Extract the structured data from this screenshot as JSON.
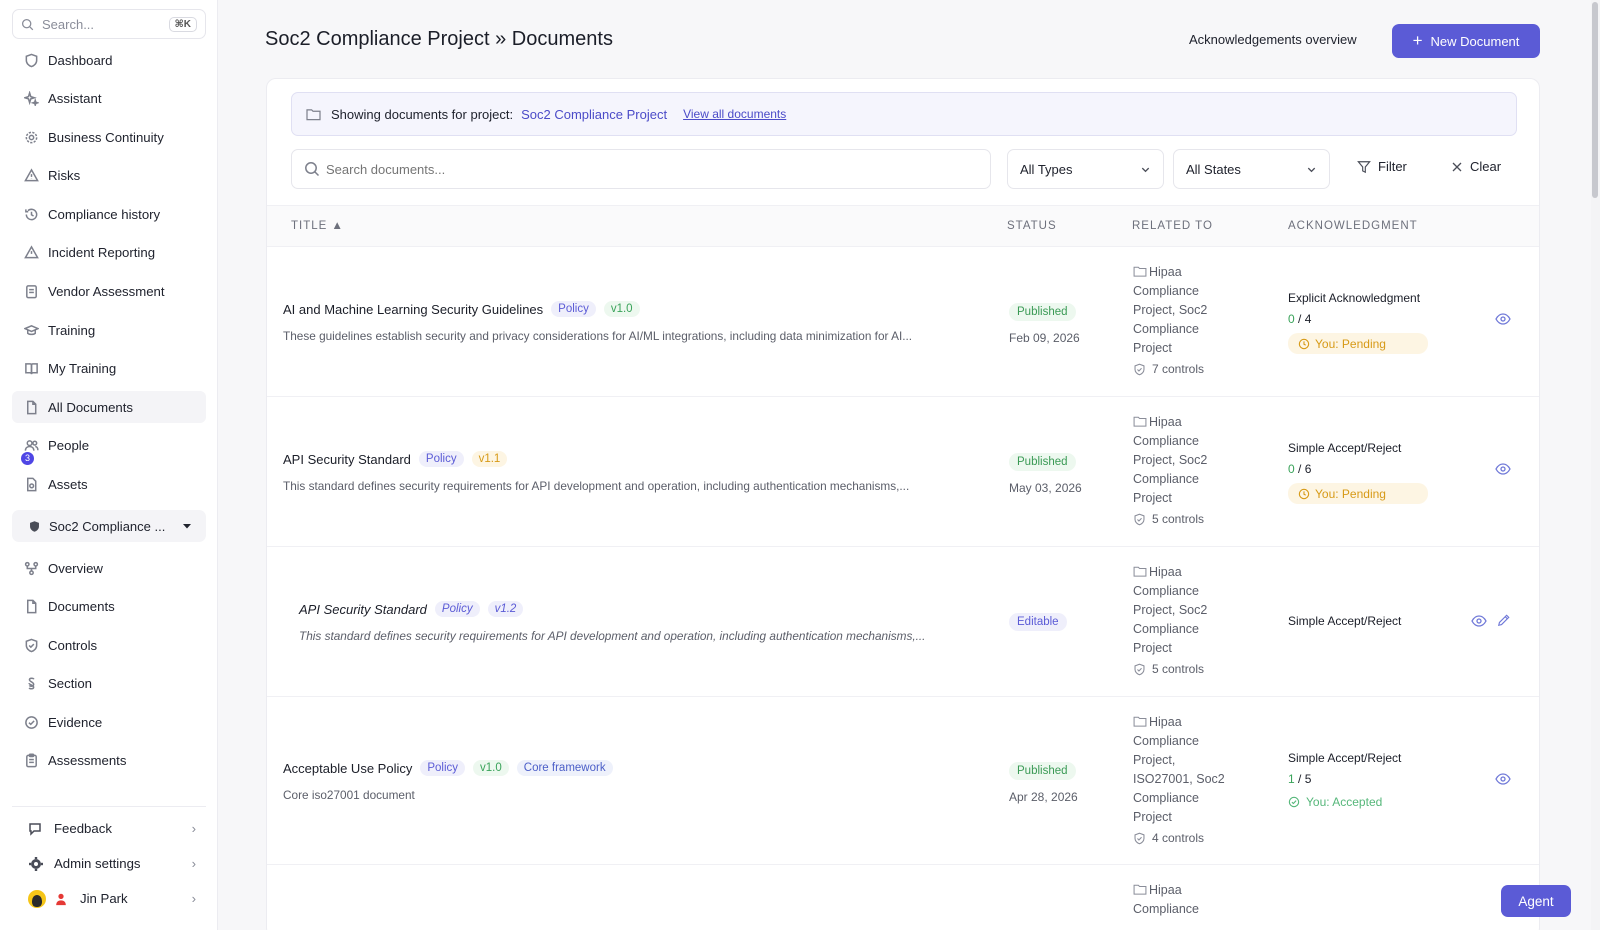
{
  "sidebar": {
    "search_placeholder": "Search...",
    "search_shortcut": "⌘K",
    "items": [
      {
        "label": "Dashboard",
        "icon": "shield-icon"
      },
      {
        "label": "Assistant",
        "icon": "sparkle-icon"
      },
      {
        "label": "Business Continuity",
        "icon": "gear-icon"
      },
      {
        "label": "Risks",
        "icon": "warning-icon"
      },
      {
        "label": "Compliance history",
        "icon": "history-icon"
      },
      {
        "label": "Incident Reporting",
        "icon": "alert-icon"
      },
      {
        "label": "Vendor Assessment",
        "icon": "clipboard-icon"
      },
      {
        "label": "Training",
        "icon": "graduation-cap-icon"
      },
      {
        "label": "My Training",
        "icon": "book-icon"
      },
      {
        "label": "All Documents",
        "icon": "document-icon"
      },
      {
        "label": "People",
        "icon": "people-icon",
        "badge": "3"
      },
      {
        "label": "Assets",
        "icon": "assets-icon"
      }
    ],
    "project_selector": "Soc2 Compliance ...",
    "project_items": [
      {
        "label": "Overview",
        "icon": "flow-icon"
      },
      {
        "label": "Documents",
        "icon": "document-icon"
      },
      {
        "label": "Controls",
        "icon": "shield-check-icon"
      },
      {
        "label": "Section",
        "icon": "section-icon"
      },
      {
        "label": "Evidence",
        "icon": "check-circle-icon"
      },
      {
        "label": "Assessments",
        "icon": "clipboard-icon"
      }
    ],
    "bottom": {
      "feedback": "Feedback",
      "admin": "Admin settings",
      "user": "Jin Park"
    }
  },
  "header": {
    "title": "Soc2 Compliance Project » Documents",
    "ack_overview": "Acknowledgements overview",
    "new_document": "New Document"
  },
  "banner": {
    "showing": "Showing documents for project:",
    "project": "Soc2 Compliance Project",
    "view_all": "View all documents"
  },
  "filters": {
    "search_placeholder": "Search documents...",
    "types": "All Types",
    "states": "All States",
    "filter": "Filter",
    "clear": "Clear"
  },
  "table": {
    "headers": {
      "title": "TITLE",
      "sort_indicator": "▲",
      "status": "STATUS",
      "related": "RELATED TO",
      "ack": "ACKNOWLEDGMENT"
    },
    "rows": [
      {
        "title": "AI and Machine Learning Security Guidelines",
        "type": "Policy",
        "version": "v1.0",
        "desc": "These guidelines establish security and privacy considerations for AI/ML integrations, including data minimization for AI...",
        "status": "Published",
        "date": "Feb 09, 2026",
        "related_lines": [
          "Hipaa",
          "Compliance",
          "Project, Soc2",
          "Compliance",
          "Project"
        ],
        "controls": "7 controls",
        "ack_type": "Explicit Acknowledgment",
        "ack_done": "0",
        "ack_total": "/ 4",
        "ack_state": "You: Pending"
      },
      {
        "title": "API Security Standard",
        "type": "Policy",
        "version": "v1.1",
        "desc": "This standard defines security requirements for API development and operation, including authentication mechanisms,...",
        "status": "Published",
        "date": "May 03, 2026",
        "related_lines": [
          "Hipaa",
          "Compliance",
          "Project, Soc2",
          "Compliance",
          "Project"
        ],
        "controls": "5 controls",
        "ack_type": "Simple Accept/Reject",
        "ack_done": "0",
        "ack_total": "/ 6",
        "ack_state": "You: Pending"
      },
      {
        "title": "API Security Standard",
        "type": "Policy",
        "version": "v1.2",
        "desc": "This standard defines security requirements for API development and operation, including authentication mechanisms,...",
        "status": "Editable",
        "related_lines": [
          "Hipaa",
          "Compliance",
          "Project, Soc2",
          "Compliance",
          "Project"
        ],
        "controls": "5 controls",
        "ack_type": "Simple Accept/Reject"
      },
      {
        "title": "Acceptable Use Policy",
        "type": "Policy",
        "version": "v1.0",
        "extra_tag": "Core framework",
        "desc": "Core iso27001 document",
        "status": "Published",
        "date": "Apr 28, 2026",
        "related_lines": [
          "Hipaa",
          "Compliance",
          "Project,",
          "ISO27001, Soc2",
          "Compliance",
          "Project"
        ],
        "controls": "4 controls",
        "ack_type": "Simple Accept/Reject",
        "ack_done": "1",
        "ack_total": "/ 5",
        "ack_state": "You: Accepted"
      },
      {
        "related_lines": [
          "Hipaa",
          "Compliance"
        ]
      }
    ]
  },
  "agent_button": "Agent",
  "colors": {
    "accent": "#5b5bd6",
    "published": "#3a9a55",
    "pending": "#d79a17"
  }
}
